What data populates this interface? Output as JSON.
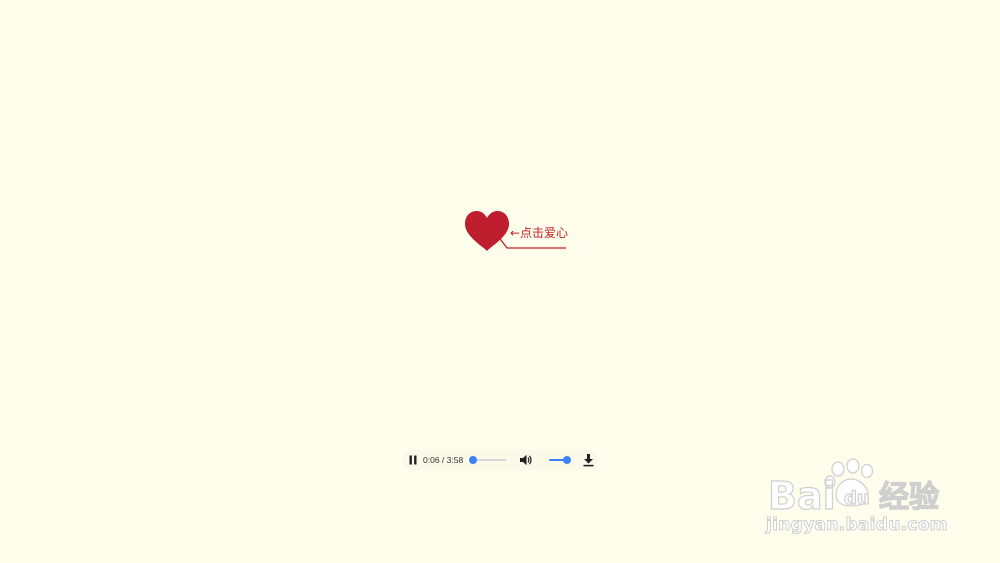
{
  "callout": {
    "text": "←点击爱心",
    "color": "#c0202a"
  },
  "heart": {
    "icon": "heart-icon",
    "color": "#be1e2d"
  },
  "player": {
    "state": "playing",
    "pause_icon": "pause-icon",
    "current_time": "0:06",
    "duration": "3:58",
    "time_display": "0:06 / 3:58",
    "progress_fraction": 0.025,
    "volume_icon": "volume-icon",
    "volume_fraction": 1.0,
    "download_icon": "download-icon",
    "accent_color": "#3b82f6"
  },
  "watermark": {
    "logo_text": "Bai du 经验",
    "url": "jingyan.baidu.com"
  }
}
